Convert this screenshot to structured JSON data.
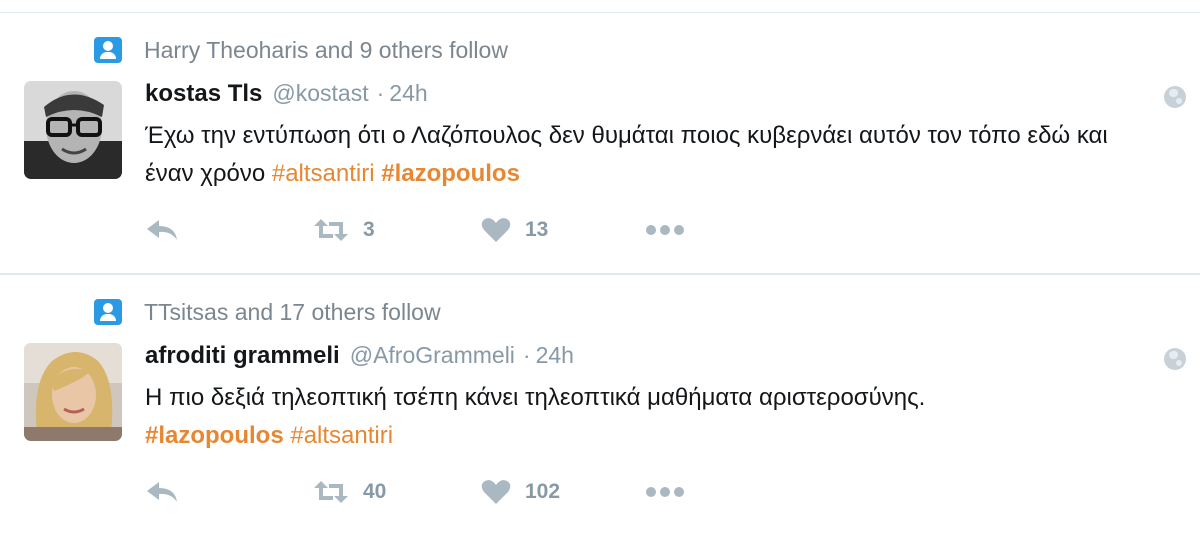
{
  "colors": {
    "accent_hashtag": "#e78731",
    "secondary_text": "#8899a6",
    "icon_gray": "#aab8c2",
    "context_icon": "#2b9ae4",
    "divider": "#e1e8ed"
  },
  "tweets": [
    {
      "context_text": "Harry Theoharis and 9 others follow",
      "context_icon": "follow-person-icon",
      "name": "kostas Tls",
      "handle": "@kostast",
      "separator": "·",
      "time": "24h",
      "text": "Έχω την εντύπωση ότι ο Λαζόπουλος δεν θυμάται ποιος κυβερνάει αυτόν τον τόπο εδώ και έναν χρόνο ",
      "hashtags": [
        "#altsantiri",
        "#lazopoulos"
      ],
      "retweet_count": "3",
      "like_count": "13",
      "icons": [
        "reply-icon",
        "retweet-icon",
        "like-icon",
        "more-icon",
        "globe-icon"
      ]
    },
    {
      "context_text": "TTsitsas and 17 others follow",
      "context_icon": "follow-person-icon",
      "name": "afroditi grammeli",
      "handle": "@AfroGrammeli",
      "separator": "·",
      "time": "24h",
      "text": "Η πιο δεξιά τηλεοπτική τσέπη κάνει τηλεοπτικά μαθήματα αριστεροσύνης.",
      "hashtags": [
        "#lazopoulos",
        "#altsantiri"
      ],
      "retweet_count": "40",
      "like_count": "102",
      "icons": [
        "reply-icon",
        "retweet-icon",
        "like-icon",
        "more-icon",
        "globe-icon"
      ]
    }
  ]
}
